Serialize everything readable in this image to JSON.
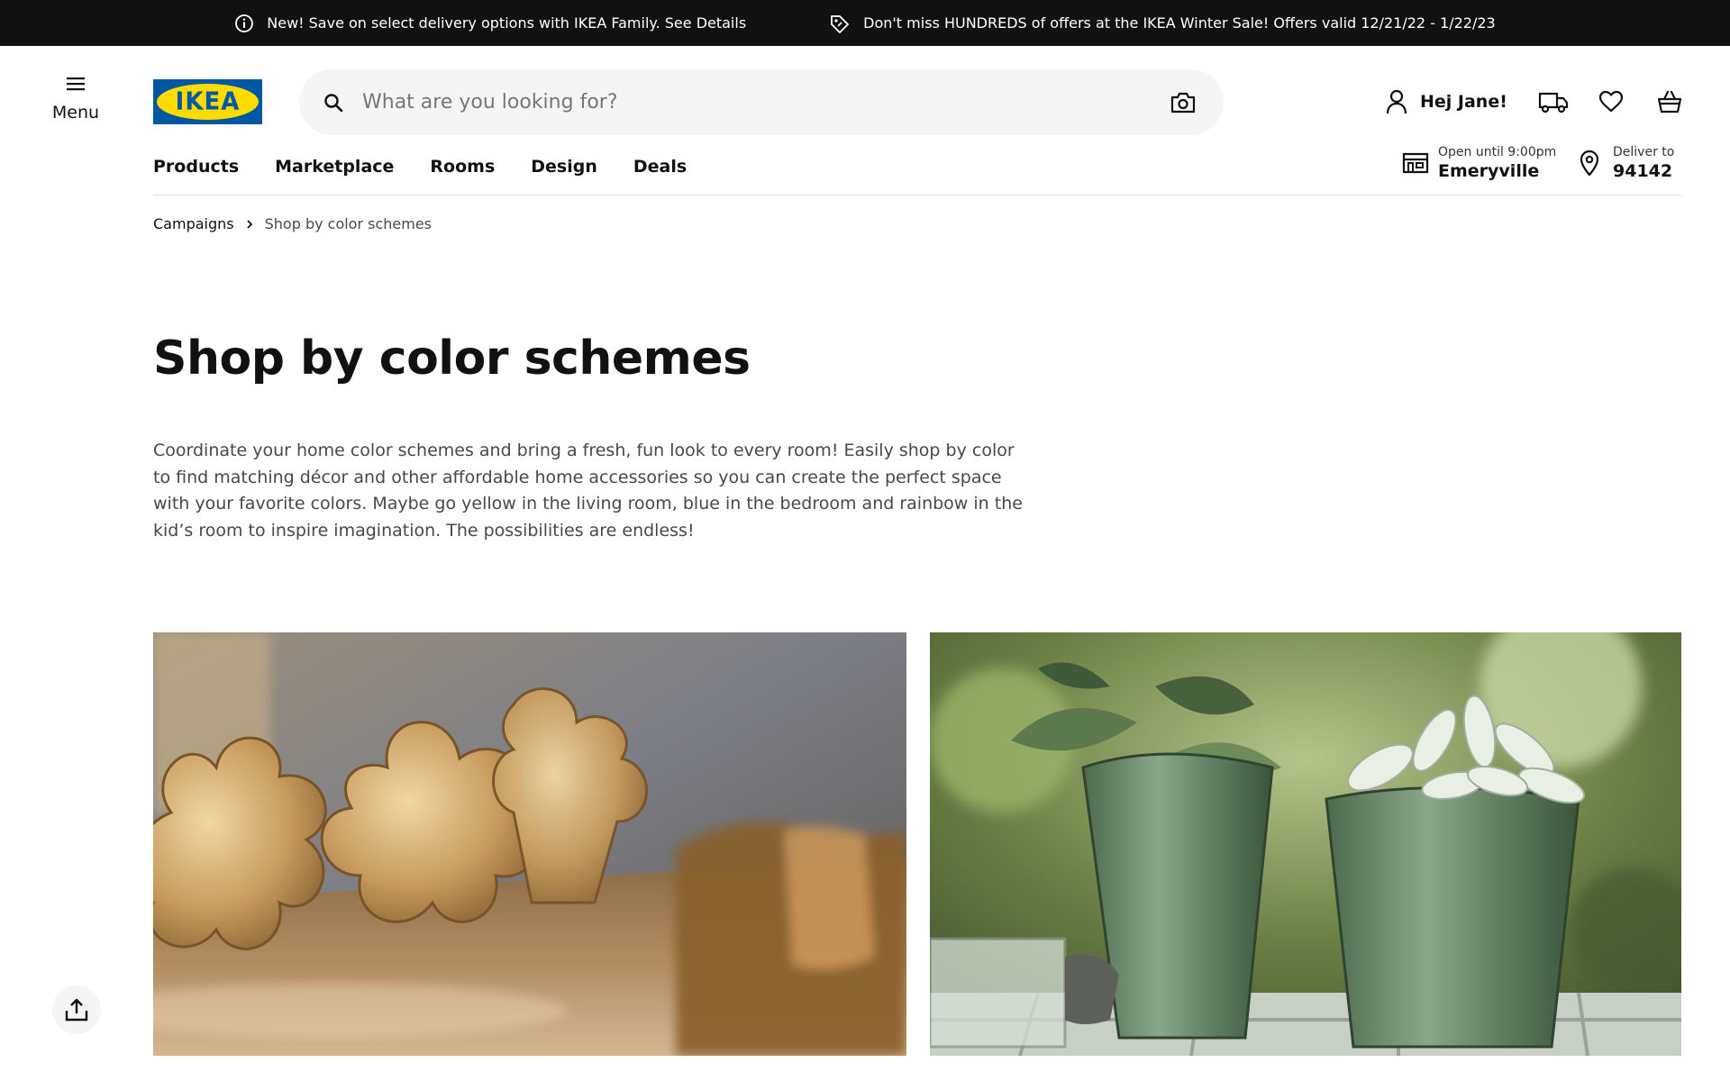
{
  "announcements": [
    {
      "icon": "info-icon",
      "text": "New! Save on select delivery options with IKEA Family. See Details"
    },
    {
      "icon": "price-tag-icon",
      "text": "Don't miss HUNDREDS of offers at the IKEA Winter Sale! Offers valid 12/21/22 - 1/22/23"
    }
  ],
  "header": {
    "menu_label": "Menu",
    "logo_text": "IKEA",
    "search_placeholder": "What are you looking for?",
    "greeting": "Hej Jane!",
    "icons": [
      "user-icon",
      "delivery-truck-icon",
      "heart-icon",
      "shopping-bag-icon",
      "camera-icon",
      "search-icon",
      "hamburger-icon"
    ]
  },
  "nav": {
    "items": [
      "Products",
      "Marketplace",
      "Rooms",
      "Design",
      "Deals"
    ],
    "store": {
      "line1": "Open until 9:00pm",
      "line2": "Emeryville"
    },
    "delivery": {
      "line1": "Deliver to",
      "line2": "94142"
    }
  },
  "breadcrumb": [
    "Campaigns",
    "Shop by color schemes"
  ],
  "main": {
    "title": "Shop by color schemes",
    "intro": "Coordinate your home color schemes and bring a fresh, fun look to every room! Easily shop by color to find matching décor and other affordable home accessories so you can create the perfect space with your favorite colors. Maybe go yellow in the living room, blue in the bedroom and rainbow in the kid’s room to inspire imagination. The possibilities are endless!"
  },
  "images": [
    "gold-flower-bowls-image",
    "green-glass-planters-image"
  ],
  "colors": {
    "topbar": "#111111",
    "brand_blue": "#0058a3",
    "brand_yellow": "#ffdb00",
    "search_bg": "#f5f5f5"
  }
}
